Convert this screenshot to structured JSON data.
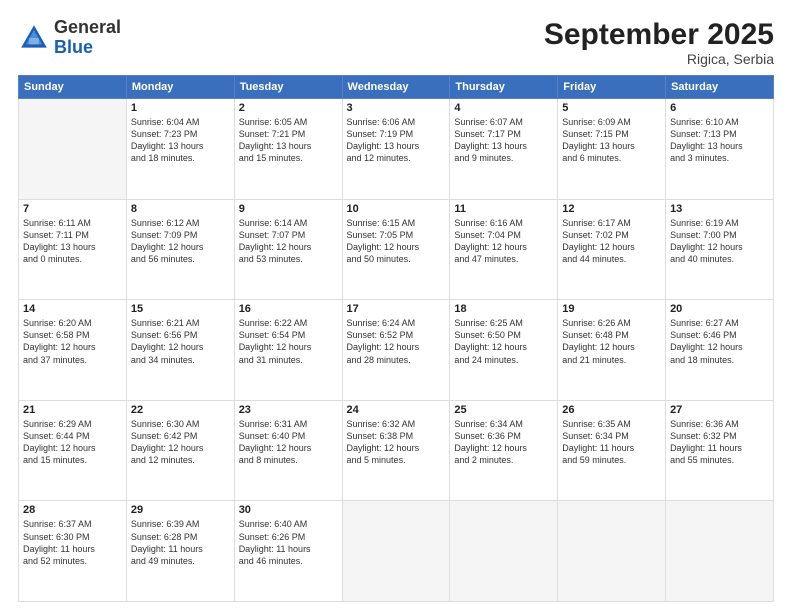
{
  "header": {
    "logo": {
      "general": "General",
      "blue": "Blue"
    },
    "title": "September 2025",
    "subtitle": "Rigica, Serbia"
  },
  "days_of_week": [
    "Sunday",
    "Monday",
    "Tuesday",
    "Wednesday",
    "Thursday",
    "Friday",
    "Saturday"
  ],
  "weeks": [
    [
      {
        "day": "",
        "info": ""
      },
      {
        "day": "1",
        "info": "Sunrise: 6:04 AM\nSunset: 7:23 PM\nDaylight: 13 hours\nand 18 minutes."
      },
      {
        "day": "2",
        "info": "Sunrise: 6:05 AM\nSunset: 7:21 PM\nDaylight: 13 hours\nand 15 minutes."
      },
      {
        "day": "3",
        "info": "Sunrise: 6:06 AM\nSunset: 7:19 PM\nDaylight: 13 hours\nand 12 minutes."
      },
      {
        "day": "4",
        "info": "Sunrise: 6:07 AM\nSunset: 7:17 PM\nDaylight: 13 hours\nand 9 minutes."
      },
      {
        "day": "5",
        "info": "Sunrise: 6:09 AM\nSunset: 7:15 PM\nDaylight: 13 hours\nand 6 minutes."
      },
      {
        "day": "6",
        "info": "Sunrise: 6:10 AM\nSunset: 7:13 PM\nDaylight: 13 hours\nand 3 minutes."
      }
    ],
    [
      {
        "day": "7",
        "info": "Sunrise: 6:11 AM\nSunset: 7:11 PM\nDaylight: 13 hours\nand 0 minutes."
      },
      {
        "day": "8",
        "info": "Sunrise: 6:12 AM\nSunset: 7:09 PM\nDaylight: 12 hours\nand 56 minutes."
      },
      {
        "day": "9",
        "info": "Sunrise: 6:14 AM\nSunset: 7:07 PM\nDaylight: 12 hours\nand 53 minutes."
      },
      {
        "day": "10",
        "info": "Sunrise: 6:15 AM\nSunset: 7:05 PM\nDaylight: 12 hours\nand 50 minutes."
      },
      {
        "day": "11",
        "info": "Sunrise: 6:16 AM\nSunset: 7:04 PM\nDaylight: 12 hours\nand 47 minutes."
      },
      {
        "day": "12",
        "info": "Sunrise: 6:17 AM\nSunset: 7:02 PM\nDaylight: 12 hours\nand 44 minutes."
      },
      {
        "day": "13",
        "info": "Sunrise: 6:19 AM\nSunset: 7:00 PM\nDaylight: 12 hours\nand 40 minutes."
      }
    ],
    [
      {
        "day": "14",
        "info": "Sunrise: 6:20 AM\nSunset: 6:58 PM\nDaylight: 12 hours\nand 37 minutes."
      },
      {
        "day": "15",
        "info": "Sunrise: 6:21 AM\nSunset: 6:56 PM\nDaylight: 12 hours\nand 34 minutes."
      },
      {
        "day": "16",
        "info": "Sunrise: 6:22 AM\nSunset: 6:54 PM\nDaylight: 12 hours\nand 31 minutes."
      },
      {
        "day": "17",
        "info": "Sunrise: 6:24 AM\nSunset: 6:52 PM\nDaylight: 12 hours\nand 28 minutes."
      },
      {
        "day": "18",
        "info": "Sunrise: 6:25 AM\nSunset: 6:50 PM\nDaylight: 12 hours\nand 24 minutes."
      },
      {
        "day": "19",
        "info": "Sunrise: 6:26 AM\nSunset: 6:48 PM\nDaylight: 12 hours\nand 21 minutes."
      },
      {
        "day": "20",
        "info": "Sunrise: 6:27 AM\nSunset: 6:46 PM\nDaylight: 12 hours\nand 18 minutes."
      }
    ],
    [
      {
        "day": "21",
        "info": "Sunrise: 6:29 AM\nSunset: 6:44 PM\nDaylight: 12 hours\nand 15 minutes."
      },
      {
        "day": "22",
        "info": "Sunrise: 6:30 AM\nSunset: 6:42 PM\nDaylight: 12 hours\nand 12 minutes."
      },
      {
        "day": "23",
        "info": "Sunrise: 6:31 AM\nSunset: 6:40 PM\nDaylight: 12 hours\nand 8 minutes."
      },
      {
        "day": "24",
        "info": "Sunrise: 6:32 AM\nSunset: 6:38 PM\nDaylight: 12 hours\nand 5 minutes."
      },
      {
        "day": "25",
        "info": "Sunrise: 6:34 AM\nSunset: 6:36 PM\nDaylight: 12 hours\nand 2 minutes."
      },
      {
        "day": "26",
        "info": "Sunrise: 6:35 AM\nSunset: 6:34 PM\nDaylight: 11 hours\nand 59 minutes."
      },
      {
        "day": "27",
        "info": "Sunrise: 6:36 AM\nSunset: 6:32 PM\nDaylight: 11 hours\nand 55 minutes."
      }
    ],
    [
      {
        "day": "28",
        "info": "Sunrise: 6:37 AM\nSunset: 6:30 PM\nDaylight: 11 hours\nand 52 minutes."
      },
      {
        "day": "29",
        "info": "Sunrise: 6:39 AM\nSunset: 6:28 PM\nDaylight: 11 hours\nand 49 minutes."
      },
      {
        "day": "30",
        "info": "Sunrise: 6:40 AM\nSunset: 6:26 PM\nDaylight: 11 hours\nand 46 minutes."
      },
      {
        "day": "",
        "info": ""
      },
      {
        "day": "",
        "info": ""
      },
      {
        "day": "",
        "info": ""
      },
      {
        "day": "",
        "info": ""
      }
    ]
  ]
}
